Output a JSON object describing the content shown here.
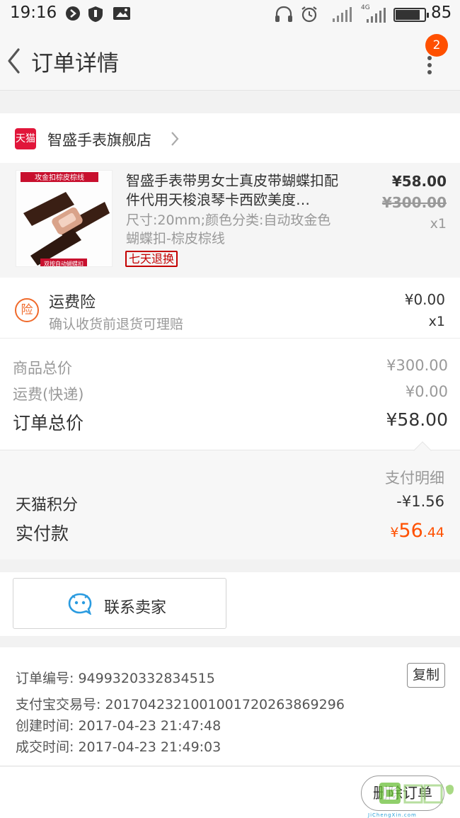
{
  "status_bar": {
    "time": "19:16",
    "network": "4G",
    "battery": "85"
  },
  "nav": {
    "title": "订单详情",
    "badge_count": "2"
  },
  "store": {
    "logo_text": "天猫",
    "name": "智盛手表旗舰店"
  },
  "item": {
    "thumb_banner": "攻金扣棕皮棕线",
    "thumb_caption": "双按自动蝴蝶扣",
    "title": "智盛手表带男女士真皮带蝴蝶扣配件代用天梭浪琴卡西欧美度…",
    "sku": "尺寸:20mm;颜色分类:自动玫金色蝴蝶扣-棕皮棕线",
    "tag": "七天退换",
    "price": "¥58.00",
    "original_price": "¥300.00",
    "quantity": "x1"
  },
  "insurance": {
    "icon_text": "险",
    "title": "运费险",
    "desc": "确认收货前退货可理赔",
    "price": "¥0.00",
    "quantity": "x1"
  },
  "totals": {
    "goods_label": "商品总价",
    "goods_value": "¥300.00",
    "shipping_label": "运费(快递)",
    "shipping_value": "¥0.00",
    "order_label": "订单总价",
    "order_value": "¥58.00"
  },
  "payment": {
    "detail_label": "支付明细",
    "points_label": "天猫积分",
    "points_value": "-¥1.56",
    "paid_label": "实付款",
    "paid_symbol": "¥",
    "paid_int": "56",
    "paid_dec": ".44"
  },
  "contact": {
    "label": "联系卖家"
  },
  "order_info": {
    "number": "订单编号: 9499320332834515",
    "copy_label": "复制",
    "alipay": "支付宝交易号: 2017042321001001720263869296",
    "created": "创建时间: 2017-04-23 21:47:48",
    "completed": "成交时间: 2017-04-23 21:49:03"
  },
  "actions": {
    "delete_label": "删除订单"
  },
  "watermark": {
    "text": "JiChengXin.com"
  },
  "colors": {
    "accent_orange": "#ff5000",
    "tmall_red": "#e1163a",
    "price_orange": "#f06a2b"
  }
}
